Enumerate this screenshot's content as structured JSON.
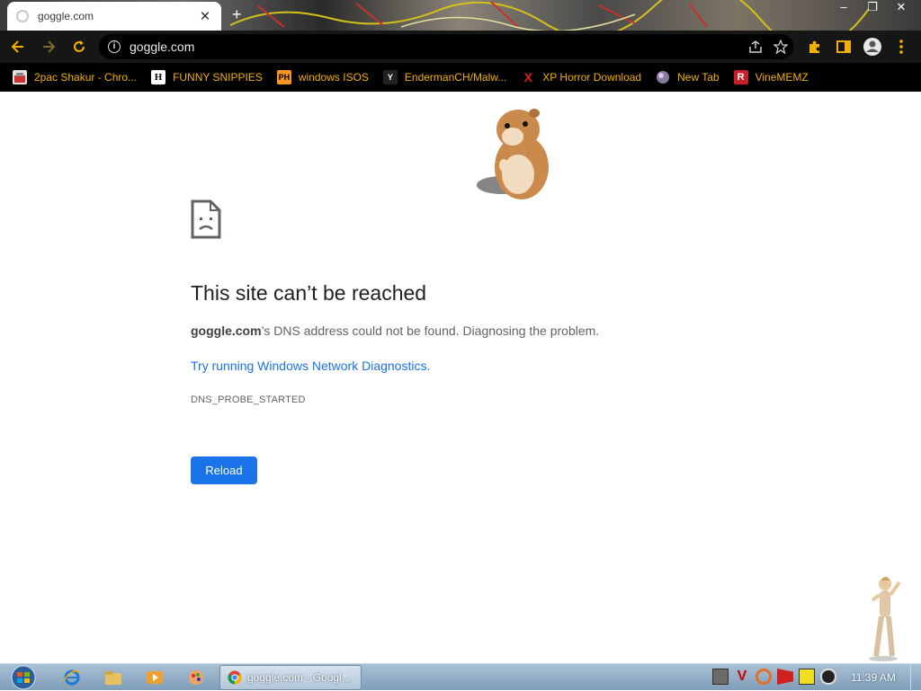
{
  "browser": {
    "tab_title": "goggle.com",
    "new_tab_symbol": "+",
    "window_controls": [
      "–",
      "❐",
      "✕"
    ],
    "url": "goggle.com"
  },
  "bookmarks": [
    {
      "label": "2pac Shakur - Chro...",
      "icon": "bookmark-2pac-icon"
    },
    {
      "label": "FUNNY SNIPPIES",
      "icon": "letter-h-icon",
      "glyph": "H"
    },
    {
      "label": "windows ISOS",
      "icon": "ph-logo-icon",
      "glyph": "PH"
    },
    {
      "label": "EndermanCH/Malw...",
      "icon": "yt-logo-icon",
      "glyph": "Y"
    },
    {
      "label": "XP Horror Download",
      "icon": "red-x-icon",
      "glyph": "X"
    },
    {
      "label": "New Tab",
      "icon": "globe-icon"
    },
    {
      "label": "VineMEMZ",
      "icon": "r-logo-icon",
      "glyph": "R"
    }
  ],
  "error_page": {
    "title": "This site can’t be reached",
    "domain": "goggle.com",
    "description_rest": "’s DNS address could not be found. Diagnosing the problem.",
    "link": "Try running Windows Network Diagnostics.",
    "code": "DNS_PROBE_STARTED",
    "reload_label": "Reload"
  },
  "taskbar": {
    "task_label": "goggle.com - Googl...",
    "clock": "11:39 AM"
  },
  "colors": {
    "link_blue": "#1a73e8",
    "bookmark_text": "#f2b000",
    "toolbar_bg": "#161616"
  }
}
